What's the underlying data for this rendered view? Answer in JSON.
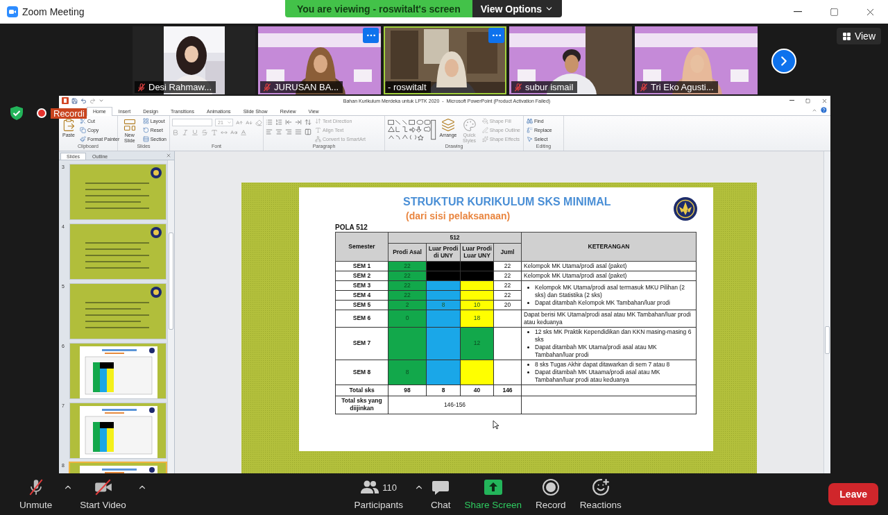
{
  "window": {
    "title": "Zoom Meeting"
  },
  "share_banner": {
    "text": "You are viewing - roswitalt's screen",
    "options": "View Options"
  },
  "video_strip": {
    "tiles": [
      {
        "name": "Desi Rahmaw...",
        "muted": true,
        "active": false,
        "more": false
      },
      {
        "name": "JURUSAN BA...",
        "muted": true,
        "active": false,
        "more": true
      },
      {
        "name": "- roswitalt",
        "muted": false,
        "active": true,
        "more": true
      },
      {
        "name": "subur ismail",
        "muted": true,
        "active": false,
        "more": false
      },
      {
        "name": "Tri Eko Agusti...",
        "muted": true,
        "active": false,
        "more": false
      }
    ],
    "view_button": "View"
  },
  "recording": {
    "label": "Recordi"
  },
  "powerpoint": {
    "title": "Bahan Kurikulum Merdeka untuk LPTK 2020  -  Microsoft PowerPoint (Product Activation Failed)",
    "tabs": [
      {
        "label": "Home",
        "selected": true
      },
      {
        "label": "Insert",
        "selected": false
      },
      {
        "label": "Design",
        "selected": false
      },
      {
        "label": "Transitions",
        "selected": false
      },
      {
        "label": "Animations",
        "selected": false
      },
      {
        "label": "Slide Show",
        "selected": false
      },
      {
        "label": "Review",
        "selected": false
      },
      {
        "label": "View",
        "selected": false
      }
    ],
    "ribbon": {
      "groups": [
        {
          "label": "Clipboard",
          "kind": "standard",
          "items": [
            {
              "label": "Paste",
              "kind": "large",
              "disabled": false
            },
            {
              "label": "Cut",
              "kind": "small",
              "disabled": false
            },
            {
              "label": "Copy",
              "kind": "small",
              "disabled": false
            },
            {
              "label": "Format Painter",
              "kind": "small",
              "disabled": false
            }
          ]
        },
        {
          "label": "Slides",
          "kind": "standard",
          "items": [
            {
              "label": "New Slide",
              "kind": "large",
              "disabled": false
            },
            {
              "label": "Layout",
              "kind": "small",
              "disabled": false
            },
            {
              "label": "Reset",
              "kind": "small",
              "disabled": false
            },
            {
              "label": "Section",
              "kind": "small",
              "disabled": false
            }
          ]
        },
        {
          "label": "Font",
          "kind": "font",
          "items": [
            {
              "label": "21",
              "kind": "size",
              "disabled": true
            }
          ]
        },
        {
          "label": "Paragraph",
          "kind": "paragraph",
          "items": [
            {
              "label": "Text Direction",
              "kind": "small",
              "disabled": true
            },
            {
              "label": "Align Text",
              "kind": "small",
              "disabled": true
            },
            {
              "label": "Convert to SmartArt",
              "kind": "small",
              "disabled": true
            }
          ]
        },
        {
          "label": "Drawing",
          "kind": "drawing",
          "items": [
            {
              "label": "Arrange",
              "kind": "large",
              "disabled": false
            },
            {
              "label": "Quick Styles",
              "kind": "large",
              "disabled": true
            },
            {
              "label": "Shape Fill",
              "kind": "small",
              "disabled": true
            },
            {
              "label": "Shape Outline",
              "kind": "small",
              "disabled": true
            },
            {
              "label": "Shape Effects",
              "kind": "small",
              "disabled": true
            }
          ]
        },
        {
          "label": "Editing",
          "kind": "standard",
          "items": [
            {
              "label": "Find",
              "kind": "small",
              "disabled": false
            },
            {
              "label": "Replace",
              "kind": "small",
              "disabled": false
            },
            {
              "label": "Select",
              "kind": "small",
              "disabled": false
            }
          ]
        }
      ]
    },
    "slides_panel": {
      "tabs": [
        {
          "label": "Slides",
          "selected": true
        },
        {
          "label": "Outline",
          "selected": false
        }
      ],
      "thumbnails": [
        {
          "number": "3",
          "kind": "text",
          "selected": false
        },
        {
          "number": "4",
          "kind": "text",
          "selected": false
        },
        {
          "number": "5",
          "kind": "text",
          "selected": false
        },
        {
          "number": "6",
          "kind": "table",
          "selected": false
        },
        {
          "number": "7",
          "kind": "table",
          "selected": false
        },
        {
          "number": "8",
          "kind": "table",
          "selected": true
        }
      ]
    },
    "slide": {
      "title": "STRUKTUR KURIKULUM SKS MINIMAL",
      "subtitle": "(dari sisi pelaksanaan)",
      "pattern": "POLA 512",
      "table": {
        "header": {
          "semester": "Semester",
          "group": "512",
          "subcolumns": [
            "Prodi Asal",
            "Luar Prodi di UNY",
            "Luar Prodi Luar UNY",
            "Juml"
          ],
          "notes": "KETERANGAN"
        },
        "rows": [
          {
            "semester": "SEM 1",
            "cells": [
              {
                "text": "22",
                "color": "#12a84b"
              },
              {
                "color": "#000000"
              },
              {
                "color": "#000000"
              }
            ],
            "juml": "22",
            "note": {
              "kind": "text",
              "text": "Kelompok MK Utama/prodi asal (paket)"
            }
          },
          {
            "semester": "SEM 2",
            "cells": [
              {
                "text": "22",
                "color": "#12a84b"
              },
              {
                "color": "#000000"
              },
              {
                "color": "#000000"
              }
            ],
            "juml": "22",
            "note": {
              "kind": "text",
              "text": "Kelompok MK Utama/prodi asal (paket)"
            }
          },
          {
            "semester": "SEM 3",
            "cells": [
              {
                "text": "22",
                "color": "#12a84b"
              },
              {
                "color": "#1aa7e8"
              },
              {
                "color": "#ffff00"
              }
            ],
            "juml": "22",
            "note": {
              "kind": "bullets",
              "items": [
                "Kelompok MK Utama/prodi asal termasuk MKU Pilihan (2 sks) dan Statistika (2 sks)",
                "Dapat ditambah Kelompok MK Tambahan/luar prodi"
              ]
            }
          },
          {
            "semester": "SEM 4",
            "cells": [
              {
                "text": "22",
                "color": "#12a84b"
              },
              {
                "color": "#1aa7e8"
              },
              {
                "color": "#ffff00"
              }
            ],
            "juml": "22"
          },
          {
            "semester": "SEM 5",
            "cells": [
              {
                "text": "2",
                "color": "#12a84b"
              },
              {
                "text": "8",
                "color": "#1aa7e8"
              },
              {
                "text": "10",
                "color": "#ffff00"
              }
            ],
            "juml": "20"
          },
          {
            "semester": "SEM 6",
            "cells": [
              {
                "text": "0",
                "color": "#12a84b"
              },
              {
                "color": "#1aa7e8"
              },
              {
                "text": "18",
                "color": "#ffff00"
              }
            ],
            "note": {
              "kind": "text",
              "text": "Dapat berisi MK Utama/prodi asal atau MK Tambahan/luar prodi atau keduanya"
            }
          },
          {
            "semester": "SEM 7",
            "cells": [
              {
                "color": "#12a84b"
              },
              {
                "color": "#1aa7e8"
              },
              {
                "text": "12",
                "color": "#12a84b"
              }
            ],
            "note": {
              "kind": "bullets",
              "items": [
                "12 sks MK Praktik Kependidikan dan KKN masing-masing 6 sks",
                "Dapat ditambah MK Utama/prodi asal atau MK Tambahan/luar prodi"
              ]
            }
          },
          {
            "semester": "SEM 8",
            "cells": [
              {
                "text": "8",
                "color": "#12a84b"
              },
              {
                "color": "#1aa7e8"
              },
              {
                "color": "#ffff00"
              }
            ],
            "note": {
              "kind": "bullets",
              "items": [
                "8 sks Tugas Akhir dapat ditawarkan di sem 7 atau 8",
                "Dapat ditambah MK Utaama/prodi asal atau MK Tambahan/luar prodi atau keduanya"
              ]
            }
          }
        ],
        "totals": [
          {
            "label": "Total sks",
            "values": [
              "98",
              "8",
              "40",
              "146"
            ]
          },
          {
            "label": "Total sks yang diijinkan",
            "values": [
              "146-156"
            ]
          }
        ]
      }
    }
  },
  "toolbar": {
    "left": [
      {
        "label": "Unmute",
        "kind": "mic",
        "caret": true
      },
      {
        "label": "Start Video",
        "kind": "video",
        "caret": true
      }
    ],
    "center": [
      {
        "label": "Participants",
        "kind": "participants",
        "count": "110",
        "caret": true
      },
      {
        "label": "Chat",
        "kind": "chat",
        "caret": false
      },
      {
        "label": "Share Screen",
        "kind": "share",
        "caret": false
      },
      {
        "label": "Record",
        "kind": "record",
        "caret": false
      },
      {
        "label": "Reactions",
        "kind": "reactions",
        "caret": false
      }
    ],
    "leave": "Leave"
  }
}
